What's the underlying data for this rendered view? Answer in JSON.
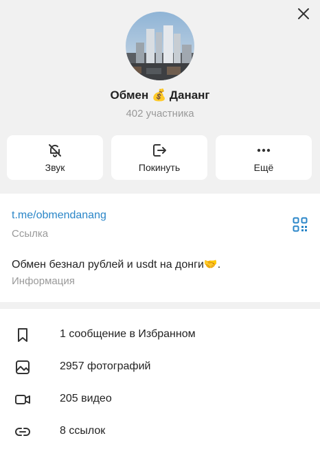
{
  "profile": {
    "title": "Обмен 💰 Дананг",
    "subtitle": "402 участника"
  },
  "actions": [
    {
      "label": "Звук",
      "icon": "bell-off-icon"
    },
    {
      "label": "Покинуть",
      "icon": "leave-icon"
    },
    {
      "label": "Ещё",
      "icon": "more-dots-icon"
    }
  ],
  "info": {
    "link": "t.me/obmendanang",
    "link_caption": "Ссылка",
    "about": "Обмен безнал рублей и usdt на донги🤝.",
    "about_caption": "Информация"
  },
  "media": [
    {
      "label": "1 сообщение в Избранном",
      "icon": "bookmark-icon"
    },
    {
      "label": "2957 фотографий",
      "icon": "photo-icon"
    },
    {
      "label": "205 видео",
      "icon": "video-icon"
    },
    {
      "label": "8 ссылок",
      "icon": "link-icon"
    }
  ],
  "colors": {
    "accent": "#2a86c8",
    "muted_text": "#999999",
    "background": "#f1f1f1"
  }
}
